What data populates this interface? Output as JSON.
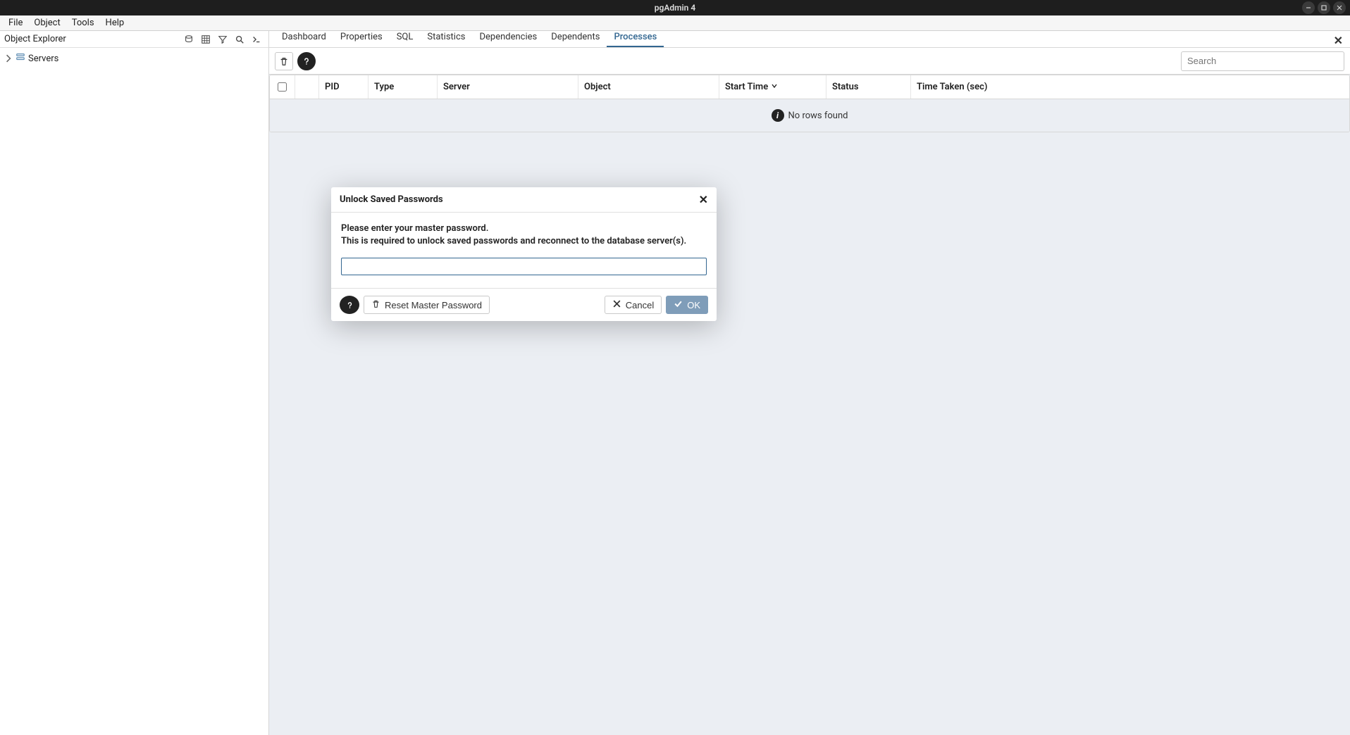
{
  "window": {
    "title": "pgAdmin 4"
  },
  "menubar": [
    "File",
    "Object",
    "Tools",
    "Help"
  ],
  "sidebar": {
    "title": "Object Explorer",
    "tree": {
      "servers_label": "Servers"
    }
  },
  "tabs": {
    "items": [
      "Dashboard",
      "Properties",
      "SQL",
      "Statistics",
      "Dependencies",
      "Dependents",
      "Processes"
    ],
    "active_index": 6
  },
  "toolbar": {
    "search_placeholder": "Search"
  },
  "table": {
    "columns": [
      "PID",
      "Type",
      "Server",
      "Object",
      "Start Time",
      "Status",
      "Time Taken (sec)"
    ],
    "sort_column_index": 4,
    "sort_dir": "desc",
    "empty_text": "No rows found"
  },
  "modal": {
    "title": "Unlock Saved Passwords",
    "line1": "Please enter your master password.",
    "line2": "This is required to unlock saved passwords and reconnect to the database server(s).",
    "reset_label": "Reset Master Password",
    "cancel_label": "Cancel",
    "ok_label": "OK"
  }
}
